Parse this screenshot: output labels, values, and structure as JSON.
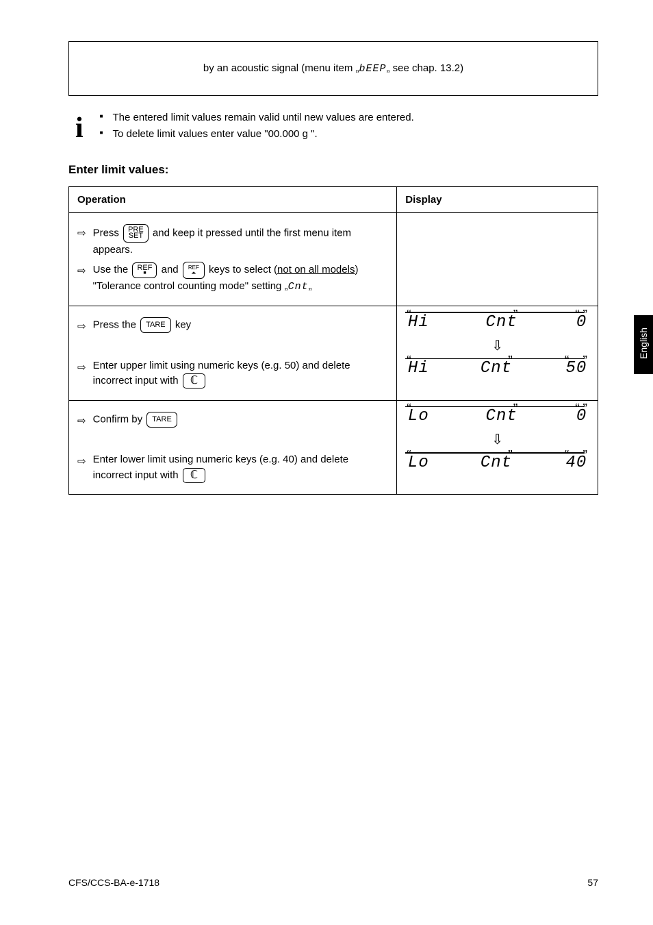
{
  "top_box_text": "by an acoustic signal (menu item „",
  "top_box_seg": "bEEP",
  "top_box_tail": "„ see chap. 13.2)",
  "bullets": {
    "b1": "The entered limit values remain valid until new values are entered.",
    "b2": "To delete limit values enter value \"00.000 g \"."
  },
  "subhead": "Enter limit values:",
  "headers": {
    "operation": "Operation",
    "display": "Display"
  },
  "row1": {
    "step1_a": "Press ",
    "step1_b": " and keep it pressed until the first menu item appears.",
    "btn_preset_l1": "PRE",
    "btn_preset_l2": "SET",
    "step2_a": "Use the ",
    "step2_b": " and ",
    "step2_c": " keys to select (",
    "step2_uline": "not on all models",
    "step2_d": ") \"Tolerance control counting mode\" setting „",
    "step2_seg": "Cnt",
    "step2_e": "„",
    "btn_ref": "REF",
    "btn_ref2_l1": "REF",
    "btn_ref2_l2": "⏶"
  },
  "row2": {
    "step1_a": "Press the ",
    "btn_tare": "TARE",
    "step1_b": " key",
    "step2_a": "Enter upper limit using numeric keys (e.g. 50) and delete incorrect input with ",
    "btn_c": "ℂ"
  },
  "row3": {
    "step1_a": "Confirm by ",
    "btn_tare": "TARE",
    "step2_a": "Enter lower limit using numeric keys (e.g. 40) and delete incorrect input with ",
    "btn_c": "ℂ"
  },
  "display": {
    "hi_label_l": "Hi",
    "cnt_label": "Cnt",
    "zero": "0",
    "fifty": "50",
    "lo_label_l": "Lo",
    "forty": "40"
  },
  "side_tab": "English",
  "footer_left": "CFS/CCS-BA-e-1718",
  "footer_right": "57"
}
